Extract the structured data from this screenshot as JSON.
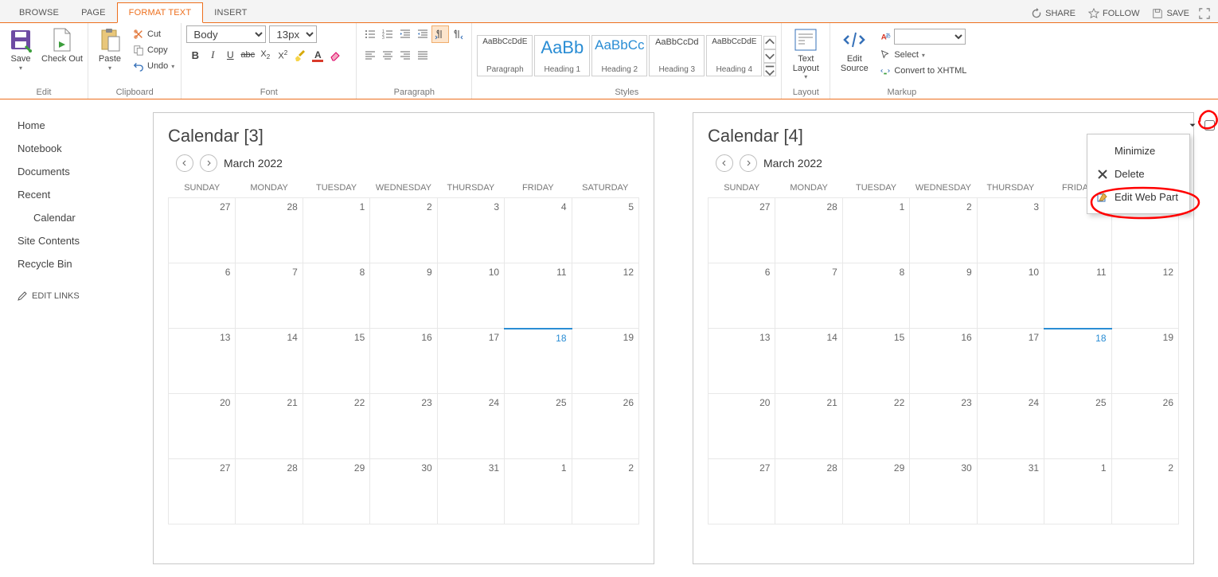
{
  "tabs": {
    "browse": "BROWSE",
    "page": "PAGE",
    "format_text": "FORMAT TEXT",
    "insert": "INSERT"
  },
  "topbar": {
    "share": "SHARE",
    "follow": "FOLLOW",
    "save": "SAVE"
  },
  "ribbon": {
    "edit": {
      "save": "Save",
      "checkout": "Check Out",
      "label": "Edit"
    },
    "clipboard": {
      "paste": "Paste",
      "cut": "Cut",
      "copy": "Copy",
      "undo": "Undo",
      "label": "Clipboard"
    },
    "font": {
      "name": "Body",
      "size": "13px",
      "label": "Font"
    },
    "paragraph": {
      "label": "Paragraph"
    },
    "styles": {
      "items": [
        {
          "sample": "AaBbCcDdE",
          "cap": "Paragraph"
        },
        {
          "sample": "AaBb",
          "cap": "Heading 1"
        },
        {
          "sample": "AaBbCc",
          "cap": "Heading 2"
        },
        {
          "sample": "AaBbCcDd",
          "cap": "Heading 3"
        },
        {
          "sample": "AaBbCcDdE",
          "cap": "Heading 4"
        }
      ],
      "label": "Styles"
    },
    "layout": {
      "text_layout": "Text\nLayout",
      "label": "Layout"
    },
    "markup": {
      "edit_source": "Edit\nSource",
      "select": "Select",
      "convert": "Convert to XHTML",
      "label": "Markup"
    }
  },
  "ql": {
    "items": [
      "Home",
      "Notebook",
      "Documents",
      "Recent"
    ],
    "sub": "Calendar",
    "items2": [
      "Site Contents",
      "Recycle Bin"
    ],
    "edit": "EDIT LINKS"
  },
  "calendar": {
    "headers": [
      "SUNDAY",
      "MONDAY",
      "TUESDAY",
      "WEDNESDAY",
      "THURSDAY",
      "FRIDAY",
      "SATURDAY"
    ],
    "month": "March 2022",
    "weeks": [
      [
        "27",
        "28",
        "1",
        "2",
        "3",
        "4",
        "5"
      ],
      [
        "6",
        "7",
        "8",
        "9",
        "10",
        "11",
        "12"
      ],
      [
        "13",
        "14",
        "15",
        "16",
        "17",
        "18",
        "19"
      ],
      [
        "20",
        "21",
        "22",
        "23",
        "24",
        "25",
        "26"
      ],
      [
        "27",
        "28",
        "29",
        "30",
        "31",
        "1",
        "2"
      ]
    ],
    "today": [
      2,
      5
    ]
  },
  "webparts": [
    {
      "title": "Calendar [3]"
    },
    {
      "title": "Calendar [4]"
    }
  ],
  "wp_menu": {
    "minimize": "Minimize",
    "delete": "Delete",
    "edit": "Edit Web Part"
  }
}
